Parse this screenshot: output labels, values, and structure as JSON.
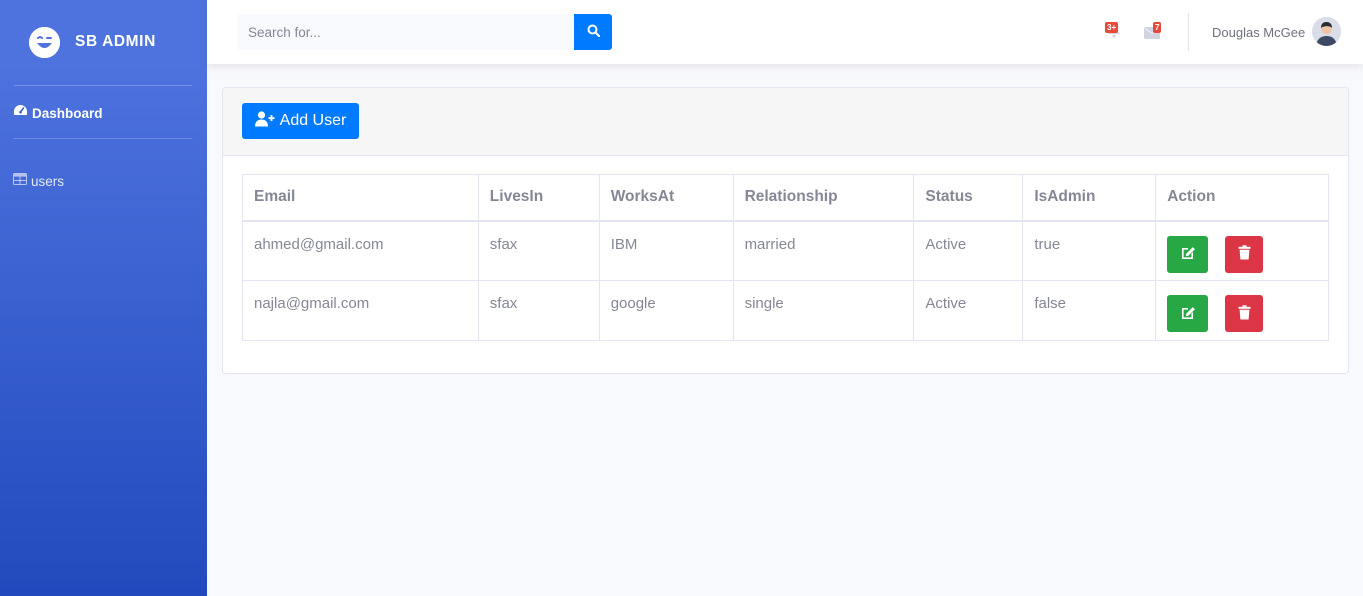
{
  "sidebar": {
    "brand": "SB ADMIN",
    "items": [
      {
        "label": "Dashboard",
        "icon": "tachometer-icon"
      },
      {
        "label": "users",
        "icon": "table-icon"
      }
    ]
  },
  "topbar": {
    "search": {
      "placeholder": "Search for..."
    },
    "alerts": {
      "badge": "3+",
      "icon": "bell-icon"
    },
    "messages": {
      "badge": "7",
      "icon": "envelope-icon"
    },
    "user_name": "Douglas McGee"
  },
  "card": {
    "add_user_label": "Add User"
  },
  "table": {
    "headers": [
      "Email",
      "LivesIn",
      "WorksAt",
      "Relationship",
      "Status",
      "IsAdmin",
      "Action"
    ],
    "rows": [
      {
        "email": "ahmed@gmail.com",
        "lives_in": "sfax",
        "works_at": "IBM",
        "relationship": "married",
        "status": "Active",
        "is_admin": "true"
      },
      {
        "email": "najla@gmail.com",
        "lives_in": "sfax",
        "works_at": "google",
        "relationship": "single",
        "status": "Active",
        "is_admin": "false"
      }
    ]
  },
  "colors": {
    "sidebar_top": "#4e73df",
    "sidebar_bottom": "#224abe",
    "primary": "#007bff",
    "edit": "#28a745",
    "delete": "#dc3545",
    "badge": "#e74a3b"
  }
}
